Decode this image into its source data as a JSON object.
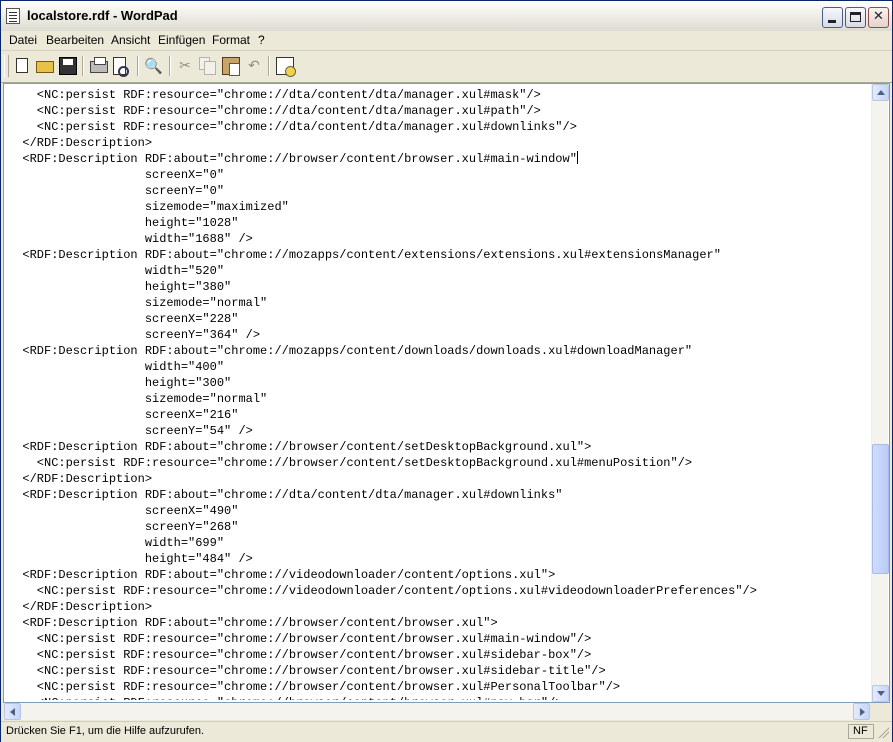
{
  "window": {
    "title": "localstore.rdf - WordPad"
  },
  "menu": [
    "Datei",
    "Bearbeiten",
    "Ansicht",
    "Einfügen",
    "Format",
    "?"
  ],
  "toolbar": [
    "new-icon",
    "open-icon",
    "save-icon",
    "print-icon",
    "print-preview-icon",
    "find-icon",
    "cut-icon",
    "copy-icon",
    "paste-icon",
    "undo-icon",
    "date-time-icon"
  ],
  "document": {
    "lines": [
      "    <NC:persist RDF:resource=\"chrome://dta/content/dta/manager.xul#mask\"/>",
      "    <NC:persist RDF:resource=\"chrome://dta/content/dta/manager.xul#path\"/>",
      "    <NC:persist RDF:resource=\"chrome://dta/content/dta/manager.xul#downlinks\"/>",
      "  </RDF:Description>",
      "  <RDF:Description RDF:about=\"chrome://browser/content/browser.xul#main-window\"",
      "                   screenX=\"0\"",
      "                   screenY=\"0\"",
      "                   sizemode=\"maximized\"",
      "                   height=\"1028\"",
      "                   width=\"1688\" />",
      "  <RDF:Description RDF:about=\"chrome://mozapps/content/extensions/extensions.xul#extensionsManager\"",
      "                   width=\"520\"",
      "                   height=\"380\"",
      "                   sizemode=\"normal\"",
      "                   screenX=\"228\"",
      "                   screenY=\"364\" />",
      "  <RDF:Description RDF:about=\"chrome://mozapps/content/downloads/downloads.xul#downloadManager\"",
      "                   width=\"400\"",
      "                   height=\"300\"",
      "                   sizemode=\"normal\"",
      "                   screenX=\"216\"",
      "                   screenY=\"54\" />",
      "  <RDF:Description RDF:about=\"chrome://browser/content/setDesktopBackground.xul\">",
      "    <NC:persist RDF:resource=\"chrome://browser/content/setDesktopBackground.xul#menuPosition\"/>",
      "  </RDF:Description>",
      "  <RDF:Description RDF:about=\"chrome://dta/content/dta/manager.xul#downlinks\"",
      "                   screenX=\"490\"",
      "                   screenY=\"268\"",
      "                   width=\"699\"",
      "                   height=\"484\" />",
      "  <RDF:Description RDF:about=\"chrome://videodownloader/content/options.xul\">",
      "    <NC:persist RDF:resource=\"chrome://videodownloader/content/options.xul#videodownloaderPreferences\"/>",
      "  </RDF:Description>",
      "  <RDF:Description RDF:about=\"chrome://browser/content/browser.xul\">",
      "    <NC:persist RDF:resource=\"chrome://browser/content/browser.xul#main-window\"/>",
      "    <NC:persist RDF:resource=\"chrome://browser/content/browser.xul#sidebar-box\"/>",
      "    <NC:persist RDF:resource=\"chrome://browser/content/browser.xul#sidebar-title\"/>",
      "    <NC:persist RDF:resource=\"chrome://browser/content/browser.xul#PersonalToolbar\"/>",
      "    <NC:persist RDF:resource=\"chrome://browser/content/browser.xul#nav-bar\"/>"
    ],
    "caret_line": 4
  },
  "status": {
    "text": "Drücken Sie F1, um die Hilfe aufzurufen.",
    "panel": "NF"
  }
}
